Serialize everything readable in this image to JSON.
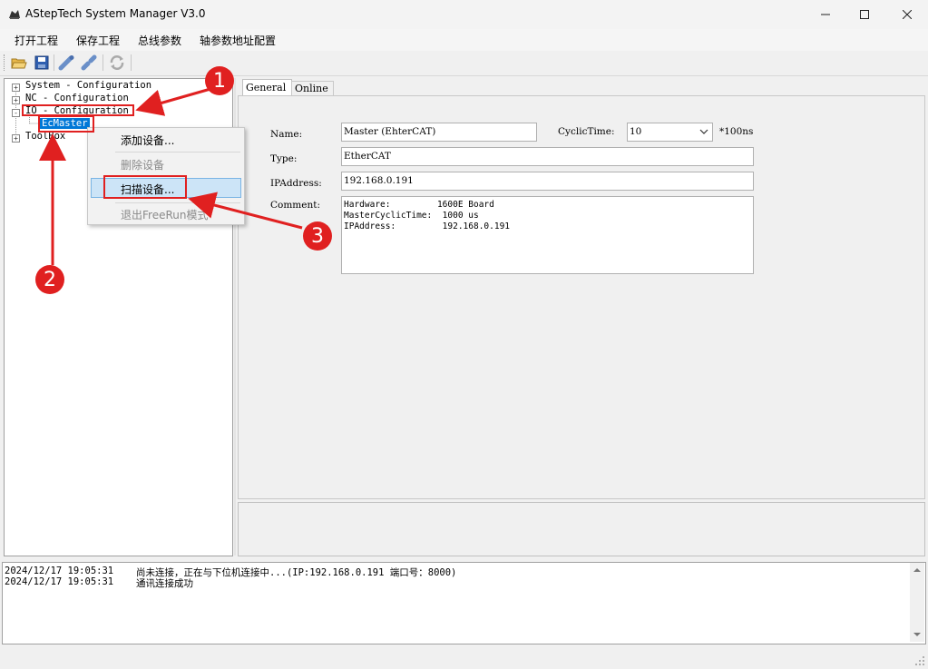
{
  "window": {
    "title": "AStepTech System Manager V3.0"
  },
  "menu": {
    "items": [
      "打开工程",
      "保存工程",
      "总线参数",
      "轴参数地址配置"
    ]
  },
  "toolbar": {
    "buttons": [
      "open-folder-icon",
      "save-disk-icon",
      "connect-icon",
      "disconnect-icon",
      "refresh-icon"
    ]
  },
  "tree": {
    "nodes": [
      {
        "label": "System - Configuration",
        "expander": "+"
      },
      {
        "label": "NC - Configuration",
        "expander": "+"
      },
      {
        "label": "IO - Configuration",
        "expander": "-"
      },
      {
        "label": "EcMaster",
        "selected": true
      },
      {
        "label": "ToolBox",
        "expander": "+"
      }
    ]
  },
  "context_menu": {
    "items": [
      {
        "label": "添加设备...",
        "enabled": true
      },
      {
        "label": "删除设备",
        "enabled": false
      },
      {
        "label": "扫描设备...",
        "enabled": true,
        "highlighted": true
      },
      {
        "label": "退出FreeRun模式",
        "enabled": false
      }
    ]
  },
  "tabs": [
    "General",
    "Online"
  ],
  "form": {
    "name_label": "Name:",
    "name_value": "Master (EhterCAT)",
    "cyclic_label": "CyclicTime:",
    "cyclic_value": "10",
    "cyclic_unit": "*100ns",
    "type_label": "Type:",
    "type_value": "EtherCAT",
    "ip_label": "IPAddress:",
    "ip_value": "192.168.0.191",
    "comment_label": "Comment:",
    "comment_value": "Hardware:         1600E Board\nMasterCyclicTime:  1000 us\nIPAddress:         192.168.0.191"
  },
  "log": {
    "rows": [
      {
        "time": "2024/12/17 19:05:31",
        "message": "尚未连接，正在与下位机连接中...(IP:192.168.0.191 端口号：8000)"
      },
      {
        "time": "2024/12/17 19:05:31",
        "message": "通讯连接成功"
      }
    ]
  },
  "annotations": {
    "badges": [
      "1",
      "2",
      "3"
    ],
    "color": "#e02020"
  },
  "colors": {
    "selection": "#0078d7",
    "highlight": "#cce4f7"
  }
}
